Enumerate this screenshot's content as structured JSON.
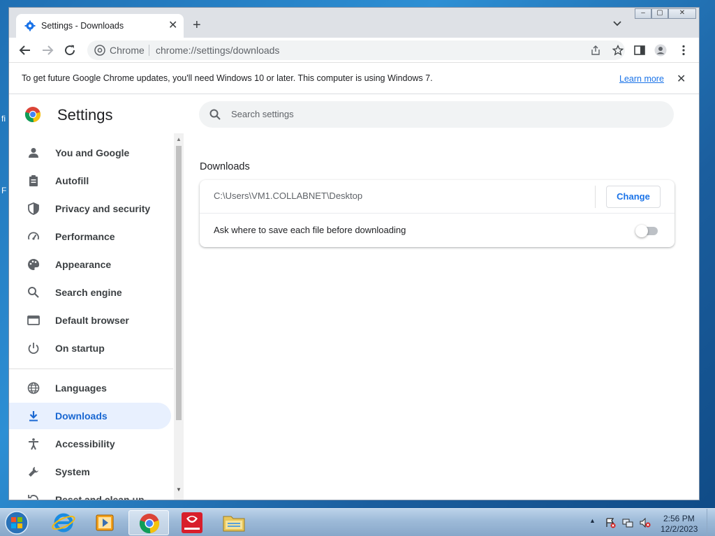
{
  "desktop": {
    "stray_text_1": "fi",
    "stray_text_2": "F"
  },
  "window": {
    "tab_title": "Settings - Downloads",
    "tab_close": "✕",
    "new_tab": "+",
    "controls": {
      "minimize": "–",
      "maximize": "▢",
      "close": "✕"
    }
  },
  "toolbar": {
    "site_label": "Chrome",
    "url": "chrome://settings/downloads"
  },
  "infobar": {
    "message": "To get future Google Chrome updates, you'll need Windows 10 or later. This computer is using Windows 7.",
    "link": "Learn more",
    "close": "✕"
  },
  "settings": {
    "title": "Settings",
    "search_placeholder": "Search settings"
  },
  "sidebar": {
    "items": [
      {
        "label": "You and Google",
        "icon": "person-icon"
      },
      {
        "label": "Autofill",
        "icon": "clipboard-icon"
      },
      {
        "label": "Privacy and security",
        "icon": "shield-icon"
      },
      {
        "label": "Performance",
        "icon": "speedometer-icon"
      },
      {
        "label": "Appearance",
        "icon": "palette-icon"
      },
      {
        "label": "Search engine",
        "icon": "search-icon"
      },
      {
        "label": "Default browser",
        "icon": "browser-window-icon"
      },
      {
        "label": "On startup",
        "icon": "power-icon"
      },
      {
        "label": "Languages",
        "icon": "globe-icon"
      },
      {
        "label": "Downloads",
        "icon": "download-icon",
        "active": true
      },
      {
        "label": "Accessibility",
        "icon": "accessibility-icon"
      },
      {
        "label": "System",
        "icon": "wrench-icon"
      },
      {
        "label": "Reset and clean up",
        "icon": "reset-icon"
      }
    ]
  },
  "downloads": {
    "section_title": "Downloads",
    "location": "C:\\Users\\VM1.COLLABNET\\Desktop",
    "change_button": "Change",
    "ask_label": "Ask where to save each file before downloading",
    "ask_enabled": false
  },
  "taskbar": {
    "apps": [
      "start-button",
      "internet-explorer",
      "media-player",
      "chrome",
      "app-red",
      "file-explorer"
    ],
    "active_app": "chrome",
    "clock_time": "2:56 PM",
    "clock_date": "12/2/2023"
  },
  "colors": {
    "accent": "#1a73e8",
    "active_nav_bg": "#e8f0fe",
    "taskbar": "#9dbad8",
    "desktop": "#1f6fb3"
  }
}
